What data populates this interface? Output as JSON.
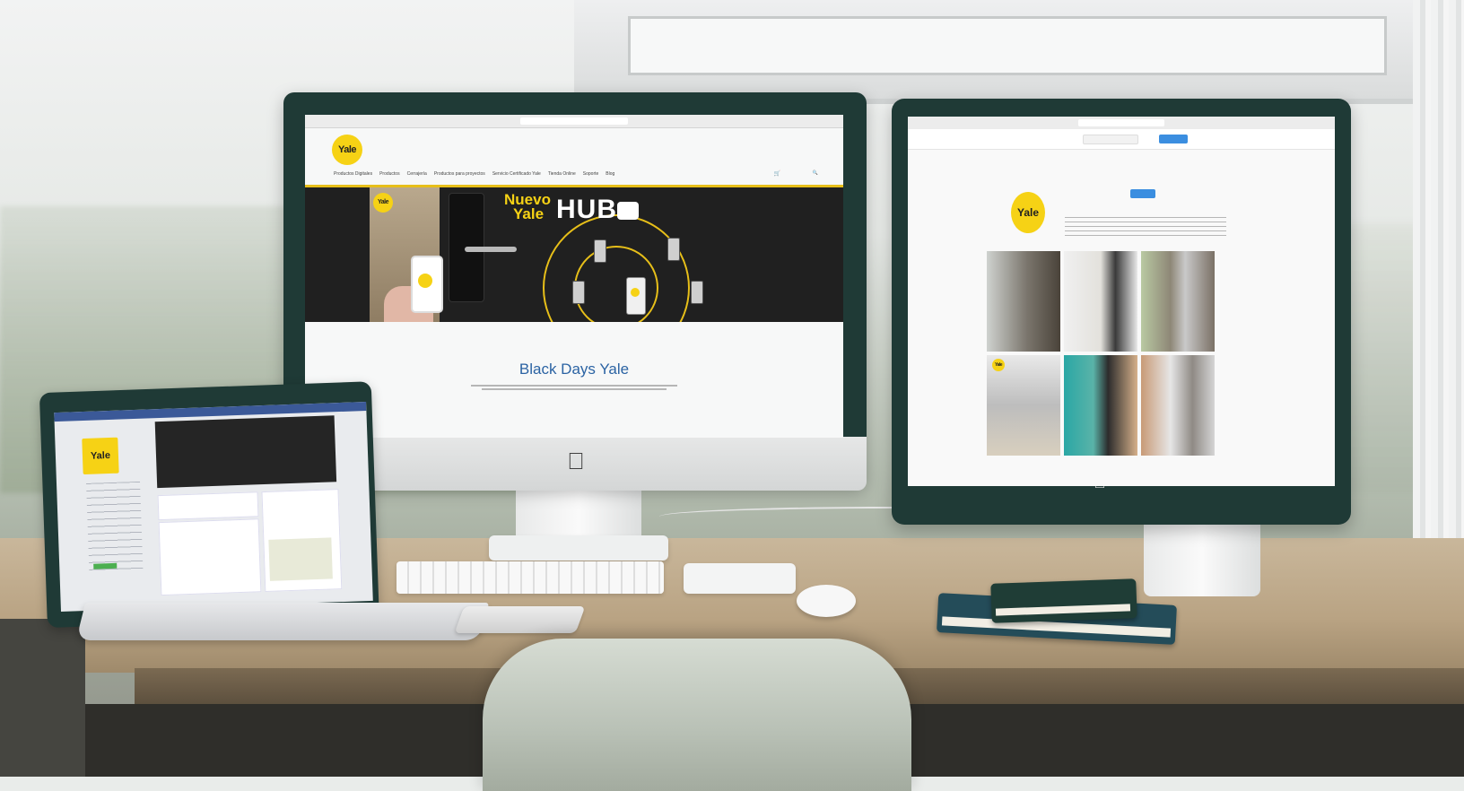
{
  "scene": {
    "description_colors": {
      "monitor_bezel": "#1f3a36",
      "brand_yellow": "#f6d215",
      "link_blue": "#2b63a3"
    }
  },
  "center_monitor": {
    "logo": "Yale",
    "nav_items": [
      "Productos Digitales",
      "Productos",
      "Cerrajería",
      "Productos para proyectos",
      "Servicio Certificado Yale",
      "Tienda Online",
      "Soporte",
      "Blog"
    ],
    "hero": {
      "title_line1": "Nuevo",
      "title_line2": "Yale",
      "title_big": "HUB"
    },
    "promo_title": "Black Days Yale",
    "apple_logo": "apple-logo"
  },
  "right_monitor": {
    "logo": "Yale",
    "apple_logo": "apple-logo"
  },
  "laptop": {
    "logo": "Yale"
  }
}
